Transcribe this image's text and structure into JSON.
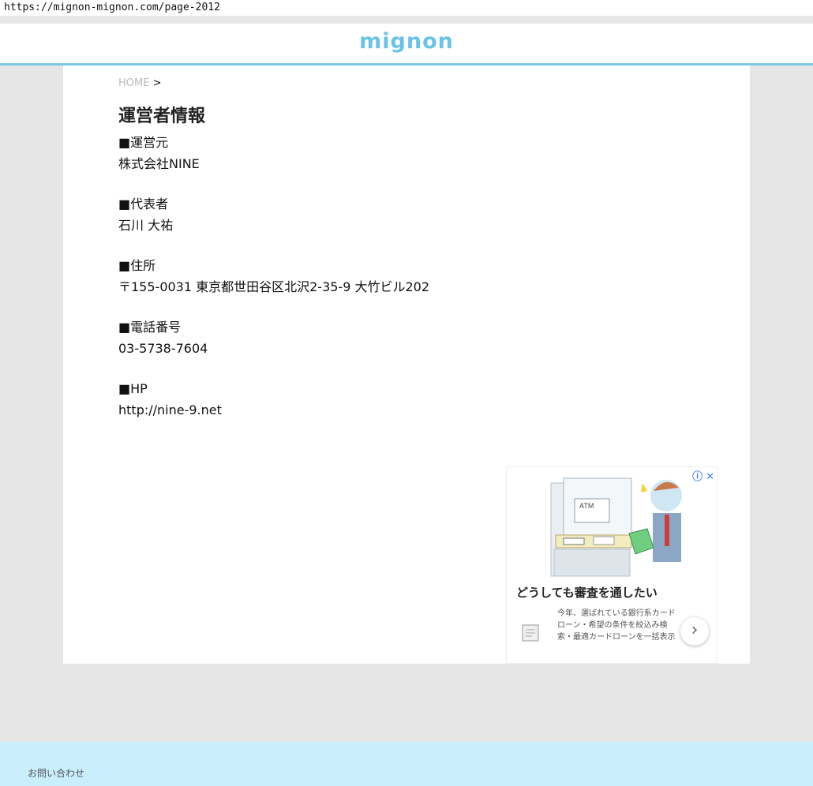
{
  "browser": {
    "url": "https://mignon-mignon.com/page-2012"
  },
  "header": {
    "logo": "mignon"
  },
  "breadcrumb": {
    "home": "HOME",
    "separator": ">"
  },
  "page": {
    "title": "運営者情報",
    "items": [
      {
        "label": "■運営元",
        "value": "株式会社NINE"
      },
      {
        "label": "■代表者",
        "value": "石川 大祐"
      },
      {
        "label": "■住所",
        "value": "〒155-0031 東京都世田谷区北沢2-35-9 大竹ビル202"
      },
      {
        "label": "■電話番号",
        "value": "03-5738-7604"
      },
      {
        "label": "■HP",
        "value": "http://nine-9.net"
      }
    ]
  },
  "ad": {
    "headline": "どうしても審査を通したい",
    "body": "今年、選ばれている銀行系カードローン・希望の条件を絞込み検索・最適カードローンを一括表示",
    "illustration_label": "ATM",
    "icons": [
      "info-icon",
      "close-icon",
      "chevron-right-icon"
    ]
  },
  "footer": {
    "contact": "お問い合わせ"
  },
  "colors": {
    "accent": "#69c3e6",
    "footer_bg": "#c9eefc",
    "page_bg": "#e6e6e6"
  }
}
